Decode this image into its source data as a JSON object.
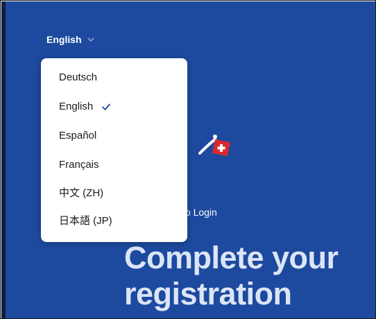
{
  "language_selector": {
    "current": "English",
    "chevron_icon": "chevron-down-icon"
  },
  "dropdown": {
    "options": [
      {
        "label": "Deutsch",
        "selected": false
      },
      {
        "label": "English",
        "selected": true
      },
      {
        "label": "Español",
        "selected": false
      },
      {
        "label": "Français",
        "selected": false
      },
      {
        "label": "中文 (ZH)",
        "selected": false
      },
      {
        "label": "日本語 (JP)",
        "selected": false
      }
    ],
    "check_icon": "checkmark-icon"
  },
  "page": {
    "back_link_partial": "to Login",
    "headline_line1": "Complete your",
    "headline_line2": "registration"
  },
  "colors": {
    "background": "#1d4a9f",
    "accent": "#1d4a9f",
    "logo_red": "#d9282f"
  }
}
